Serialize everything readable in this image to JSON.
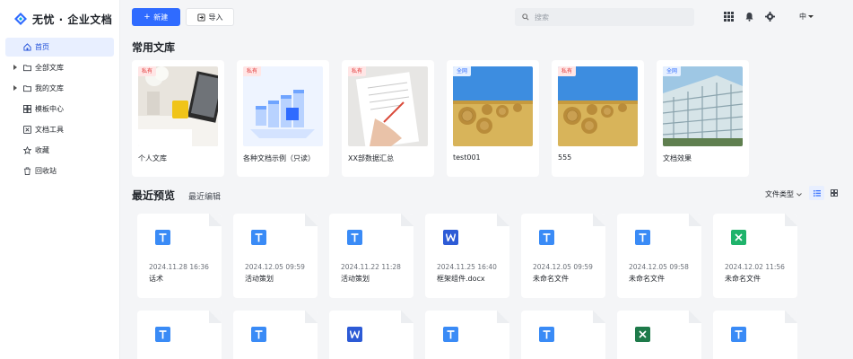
{
  "app": {
    "logo_text": "无忧 · 企业文档"
  },
  "sidebar": {
    "items": [
      {
        "label": "首页",
        "icon": "home-icon",
        "active": true,
        "caret": false
      },
      {
        "label": "全部文库",
        "icon": "folder-icon",
        "active": false,
        "caret": true
      },
      {
        "label": "我的文库",
        "icon": "folder-icon",
        "active": false,
        "caret": true
      },
      {
        "label": "模板中心",
        "icon": "template-icon",
        "active": false,
        "caret": false
      },
      {
        "label": "文档工具",
        "icon": "tools-icon",
        "active": false,
        "caret": false
      },
      {
        "label": "收藏",
        "icon": "star-icon",
        "active": false,
        "caret": false
      },
      {
        "label": "回收站",
        "icon": "trash-icon",
        "active": false,
        "caret": false
      }
    ]
  },
  "toolbar": {
    "new_label": "新建",
    "import_label": "导入",
    "search_placeholder": "搜索",
    "lang_label": "中"
  },
  "libraries": {
    "title": "常用文库",
    "items": [
      {
        "name": "个人文库",
        "tag": "私有",
        "tag_type": "priv",
        "image": "desk-photo"
      },
      {
        "name": "各种文档示例（只读）",
        "tag": "私有",
        "tag_type": "priv",
        "image": "illustration"
      },
      {
        "name": "XX部数据汇总",
        "tag": "私有",
        "tag_type": "priv",
        "image": "writing-photo"
      },
      {
        "name": "test001",
        "tag": "全网",
        "tag_type": "pub",
        "image": "hay-photo"
      },
      {
        "name": "555",
        "tag": "私有",
        "tag_type": "priv",
        "image": "hay-photo"
      },
      {
        "name": "文档效果",
        "tag": "全网",
        "tag_type": "pub",
        "image": "building-photo"
      }
    ]
  },
  "recent": {
    "tab_preview": "最近预览",
    "tab_edit": "最近编辑",
    "filter_label": "文件类型",
    "row1": [
      {
        "type": "T",
        "date": "2024.11.28 16:36",
        "title": "话术"
      },
      {
        "type": "T",
        "date": "2024.12.05 09:59",
        "title": "活动策划"
      },
      {
        "type": "T",
        "date": "2024.11.22 11:28",
        "title": "活动策划"
      },
      {
        "type": "W",
        "date": "2024.11.25 16:40",
        "title": "框架组件.docx"
      },
      {
        "type": "T",
        "date": "2024.12.05 09:59",
        "title": "未命名文件"
      },
      {
        "type": "T",
        "date": "2024.12.05 09:58",
        "title": "未命名文件"
      },
      {
        "type": "X",
        "date": "2024.12.02 11:56",
        "title": "未命名文件"
      }
    ],
    "row2": [
      {
        "type": "T"
      },
      {
        "type": "T"
      },
      {
        "type": "W"
      },
      {
        "type": "T"
      },
      {
        "type": "T"
      },
      {
        "type": "X2"
      },
      {
        "type": "T"
      }
    ]
  },
  "colors": {
    "accent": "#2f6bff",
    "doc_T": "#3a8bf6",
    "doc_W": "#2d5bd6",
    "doc_X": "#1fb36b",
    "doc_X2": "#1e7a4a"
  }
}
